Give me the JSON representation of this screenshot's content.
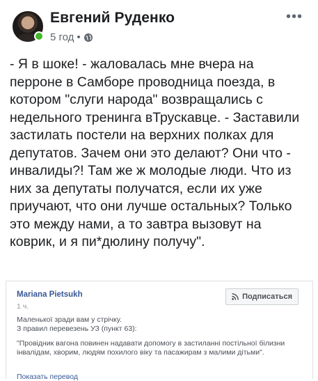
{
  "post": {
    "author": "Евгений Руденко",
    "time": "5 год",
    "separator": "•",
    "visibility_icon": "globe-icon",
    "more_icon": "•••",
    "text": "- Я в шоке! - жаловалась мне вчера на перроне в Самборе проводница поезда, в котором \"слуги народа\" возвращались с недельного тренинга вТрускавце. - Заставили застилать постели на верхних полках для депутатов. Зачем они это делают? Они что - инвалиды?! Там же ж молодые люди. Что из них за депутаты получатся, если их уже приучают, что они лучше остальных? Только это между нами, а то завтра вызовут на коврик, и я пи*дюлину получу\"."
  },
  "comment": {
    "author": "Mariana Pietsukh",
    "time": "1 ч.",
    "subscribe_label": "Подписаться",
    "line1": "Маленької зради вам у стрічку.",
    "line2": "З правил перевезень УЗ (пункт 63):",
    "quote": "\"Провідник вагона повинен надавати допомогу в застиланні постільної білизни інвалідам, хворим, людям похилого віку та пасажирам з малими дітьми\".",
    "show_translation": "Показать перевод"
  },
  "colors": {
    "link": "#385898",
    "online": "#42b72a",
    "secondary_text": "#606770"
  }
}
